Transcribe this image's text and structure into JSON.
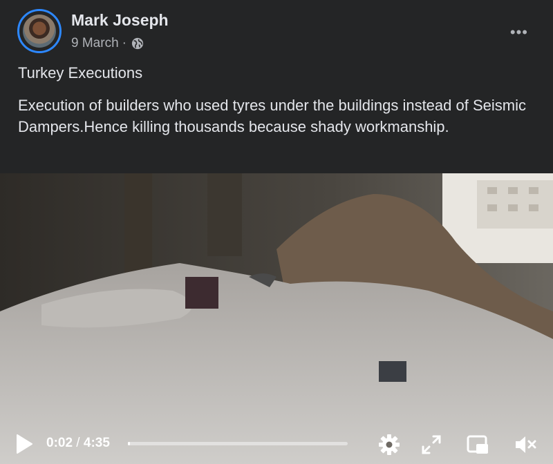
{
  "post": {
    "author": "Mark Joseph",
    "date": "9 March",
    "date_separator": "·",
    "audience_icon": "globe-icon",
    "more_label": "•••",
    "title": "Turkey Executions",
    "body": "Execution of builders who used tyres under the buildings instead of Seismic Dampers.Hence killing thousands because shady workmanship."
  },
  "video": {
    "current_time": "0:02",
    "time_separator": " / ",
    "duration": "4:35",
    "progress_fraction": 0.0073,
    "controls": [
      "play-icon",
      "gear-icon",
      "fullscreen-icon",
      "pip-icon",
      "mute-icon"
    ]
  },
  "colors": {
    "background": "#242526",
    "text": "#e4e6eb",
    "secondary": "#b0b3b8",
    "avatar_ring": "#2d88ff"
  }
}
